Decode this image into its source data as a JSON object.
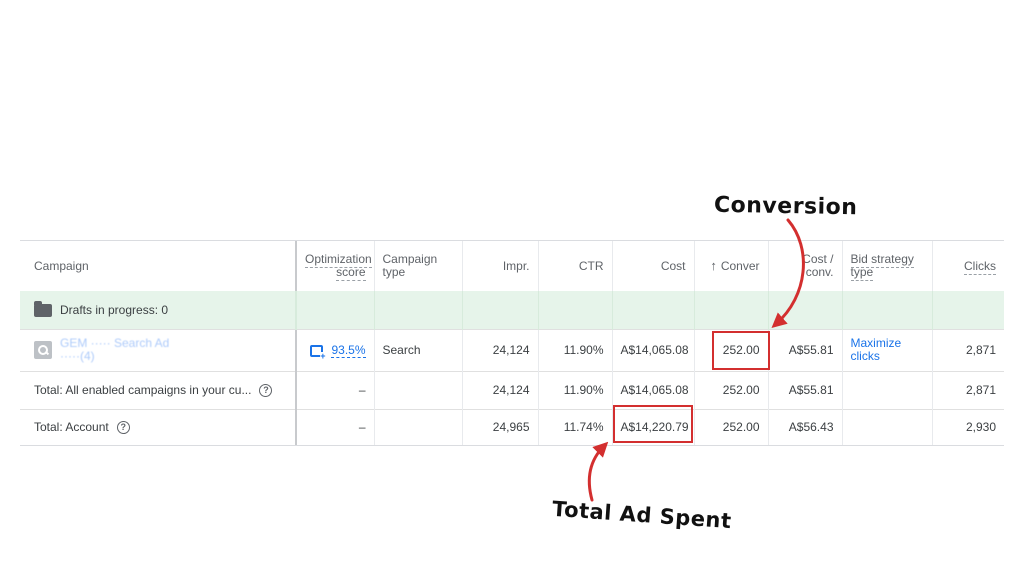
{
  "table": {
    "headers": {
      "campaign": "Campaign",
      "optimization_score": "Optimization score",
      "campaign_type": "Campaign type",
      "impr": "Impr.",
      "ctr": "CTR",
      "cost": "Cost",
      "conversions": "Conver",
      "cost_per_conv": "Cost / conv.",
      "bid_strategy": "Bid strategy type",
      "clicks": "Clicks"
    },
    "drafts": {
      "label": "Drafts in progress: 0"
    },
    "campaign_row": {
      "name": "GEM ····· Search Ad ·····(4)",
      "optimization_score": "93.5%",
      "campaign_type": "Search",
      "impr": "24,124",
      "ctr": "11.90%",
      "cost": "A$14,065.08",
      "conversions": "252.00",
      "cost_per_conv": "A$55.81",
      "bid_strategy": "Maximize clicks",
      "clicks": "2,871"
    },
    "total_enabled_row": {
      "label": "Total: All enabled campaigns in your cu...",
      "optimization_score": "–",
      "impr": "24,124",
      "ctr": "11.90%",
      "cost": "A$14,065.08",
      "conversions": "252.00",
      "cost_per_conv": "A$55.81",
      "clicks": "2,871"
    },
    "total_account_row": {
      "label": "Total: Account",
      "optimization_score": "–",
      "impr": "24,965",
      "ctr": "11.74%",
      "cost": "A$14,220.79",
      "conversions": "252.00",
      "cost_per_conv": "A$56.43",
      "clicks": "2,930"
    }
  },
  "annotations": {
    "conversion": "Conversion",
    "total_ad_spent": "Total Ad Spent"
  },
  "icons": {
    "folder": "folder-icon",
    "search_campaign": "search-icon",
    "optimization": "optimization-icon",
    "help": "help-icon",
    "sort": "arrow-up-icon"
  },
  "colors": {
    "drafts_bg": "#e6f4ea",
    "link": "#1a73e8",
    "highlight": "#d32f2f"
  }
}
